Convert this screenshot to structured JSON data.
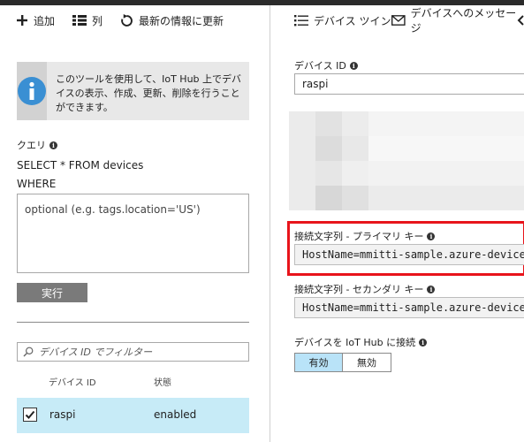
{
  "left": {
    "toolbar": {
      "add_label": "追加",
      "columns_label": "列",
      "refresh_label": "最新の情報に更新"
    },
    "info_text": "このツールを使用して、IoT Hub 上でデバイスの表示、作成、更新、削除を行うことができます。",
    "query": {
      "label": "クエリ",
      "select_line": "SELECT * FROM devices",
      "where_line": "WHERE",
      "placeholder": "optional (e.g. tags.location='US')"
    },
    "run_label": "実行",
    "filter_placeholder": "デバイス ID でフィルター",
    "table": {
      "headers": [
        "デバイス ID",
        "状態"
      ],
      "rows": [
        {
          "id": "raspi",
          "status": "enabled",
          "checked": true
        }
      ]
    }
  },
  "right": {
    "toolbar": {
      "twin_label": "デバイス ツイン",
      "message_label": "デバイスへのメッセージ"
    },
    "device_id_label": "デバイス ID",
    "device_id_value": "raspi",
    "primary_label": "接続文字列 - プライマリ キー",
    "primary_value": "HostName=mmitti-sample.azure-devices.net",
    "secondary_label": "接続文字列 - セカンダリ キー",
    "secondary_value": "HostName=mmitti-sample.azure-devices.net",
    "connect_label": "デバイスを IoT Hub に接続",
    "toggle_on": "有効",
    "toggle_off": "無効"
  },
  "colors": {
    "highlight": "#e8141b",
    "row_selected": "#c7ebf7",
    "toggle_active": "#b9e3f8",
    "run_button": "#7a7a7a"
  }
}
